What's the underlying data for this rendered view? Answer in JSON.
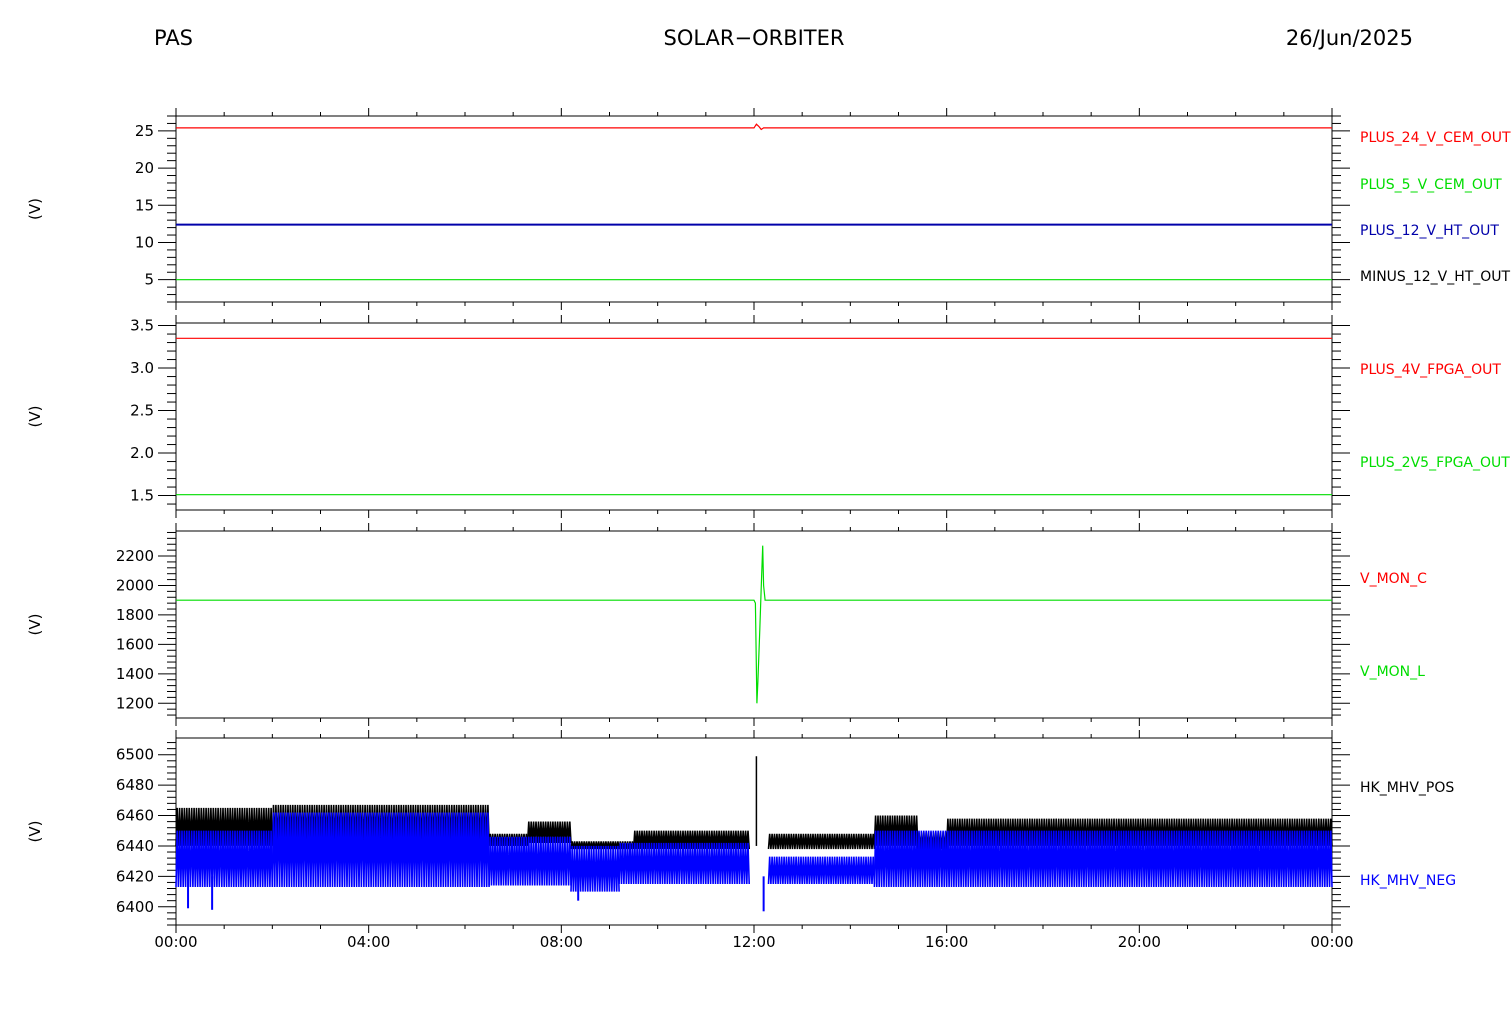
{
  "header": {
    "left": "PAS",
    "center": "SOLAR−ORBITER",
    "right": "26/Jun/2025"
  },
  "x_axis": {
    "ticks": [
      "00:00",
      "04:00",
      "08:00",
      "12:00",
      "16:00",
      "20:00",
      "00:00"
    ],
    "range_hours": [
      0,
      24
    ]
  },
  "chart_data": [
    {
      "type": "line",
      "ylabel": "(V)",
      "ylim": [
        2,
        27
      ],
      "yticks": [
        5,
        10,
        15,
        20,
        25
      ],
      "series": [
        {
          "name": "PLUS_24_V_CEM_OUT",
          "color": "#ff0000",
          "x": [
            0,
            12.0,
            12.05,
            12.1,
            12.15,
            12.2,
            24
          ],
          "y": [
            25.4,
            25.4,
            25.9,
            25.6,
            25.2,
            25.4,
            25.4
          ]
        },
        {
          "name": "PLUS_5_V_CEM_OUT",
          "color": "#00dd00",
          "x": [
            0,
            24
          ],
          "y": [
            5.0,
            5.0
          ]
        },
        {
          "name": "PLUS_12_V_HT_OUT",
          "color": "#0000aa",
          "x": [
            0,
            24
          ],
          "y": [
            12.4,
            12.4
          ]
        },
        {
          "name": "MINUS_12_V_HT_OUT",
          "color": "#000000",
          "x": [],
          "y": []
        }
      ]
    },
    {
      "type": "line",
      "ylabel": "(V)",
      "ylim": [
        1.33,
        3.53
      ],
      "yticks": [
        "1.5",
        "2.0",
        "2.5",
        "3.0",
        "3.5"
      ],
      "series": [
        {
          "name": "PLUS_4V_FPGA_OUT",
          "color": "#ff0000",
          "x": [
            0,
            24
          ],
          "y": [
            3.35,
            3.35
          ]
        },
        {
          "name": "PLUS_2V5_FPGA_OUT",
          "color": "#00dd00",
          "x": [
            0,
            24
          ],
          "y": [
            1.51,
            1.51
          ]
        }
      ]
    },
    {
      "type": "line",
      "ylabel": "(V)",
      "ylim": [
        1100,
        2370
      ],
      "yticks": [
        1200,
        1400,
        1600,
        1800,
        2000,
        2200
      ],
      "series": [
        {
          "name": "V_MON_C",
          "color": "#ff0000",
          "x": [],
          "y": []
        },
        {
          "name": "V_MON_L",
          "color": "#00dd00",
          "x": [
            0,
            12.0,
            12.03,
            12.06,
            12.08,
            12.12,
            12.15,
            12.18,
            12.2,
            12.23,
            24
          ],
          "y": [
            1900,
            1900,
            1880,
            1200,
            1350,
            1700,
            1980,
            2270,
            2000,
            1900,
            1900
          ]
        }
      ]
    },
    {
      "type": "line",
      "ylabel": "(V)",
      "ylim": [
        6388,
        6511
      ],
      "yticks": [
        6400,
        6420,
        6440,
        6460,
        6480,
        6500
      ],
      "series": [
        {
          "name": "HK_MHV_POS",
          "color": "#000000",
          "segments": [
            {
              "x0": 0,
              "x1": 2.0,
              "lo": 6440,
              "hi": 6465
            },
            {
              "x0": 2.0,
              "x1": 6.5,
              "lo": 6442,
              "hi": 6467
            },
            {
              "x0": 6.5,
              "x1": 7.3,
              "lo": 6440,
              "hi": 6448
            },
            {
              "x0": 7.3,
              "x1": 8.2,
              "lo": 6442,
              "hi": 6456
            },
            {
              "x0": 8.2,
              "x1": 9.5,
              "lo": 6438,
              "hi": 6443
            },
            {
              "x0": 9.5,
              "x1": 11.9,
              "lo": 6438,
              "hi": 6450
            },
            {
              "x0": 12.3,
              "x1": 14.5,
              "lo": 6438,
              "hi": 6448
            },
            {
              "x0": 14.5,
              "x1": 15.4,
              "lo": 6440,
              "hi": 6460
            },
            {
              "x0": 15.4,
              "x1": 16.0,
              "lo": 6438,
              "hi": 6449
            },
            {
              "x0": 16.0,
              "x1": 24,
              "lo": 6440,
              "hi": 6458
            }
          ],
          "spike": {
            "x": 12.05,
            "y": 6499
          }
        },
        {
          "name": "HK_MHV_NEG",
          "color": "#0000ff",
          "segments": [
            {
              "x0": 0,
              "x1": 2.0,
              "lo": 6413,
              "hi": 6450
            },
            {
              "x0": 2.0,
              "x1": 6.5,
              "lo": 6413,
              "hi": 6462
            },
            {
              "x0": 6.5,
              "x1": 8.2,
              "lo": 6414,
              "hi": 6446
            },
            {
              "x0": 8.2,
              "x1": 9.2,
              "lo": 6410,
              "hi": 6440
            },
            {
              "x0": 9.2,
              "x1": 11.9,
              "lo": 6415,
              "hi": 6442
            },
            {
              "x0": 12.3,
              "x1": 14.5,
              "lo": 6415,
              "hi": 6433
            },
            {
              "x0": 14.5,
              "x1": 24,
              "lo": 6413,
              "hi": 6450
            }
          ],
          "dips": [
            {
              "x": 0.25,
              "y": 6399
            },
            {
              "x": 0.75,
              "y": 6398
            },
            {
              "x": 8.35,
              "y": 6404
            },
            {
              "x": 12.2,
              "y": 6397
            }
          ]
        }
      ]
    }
  ]
}
